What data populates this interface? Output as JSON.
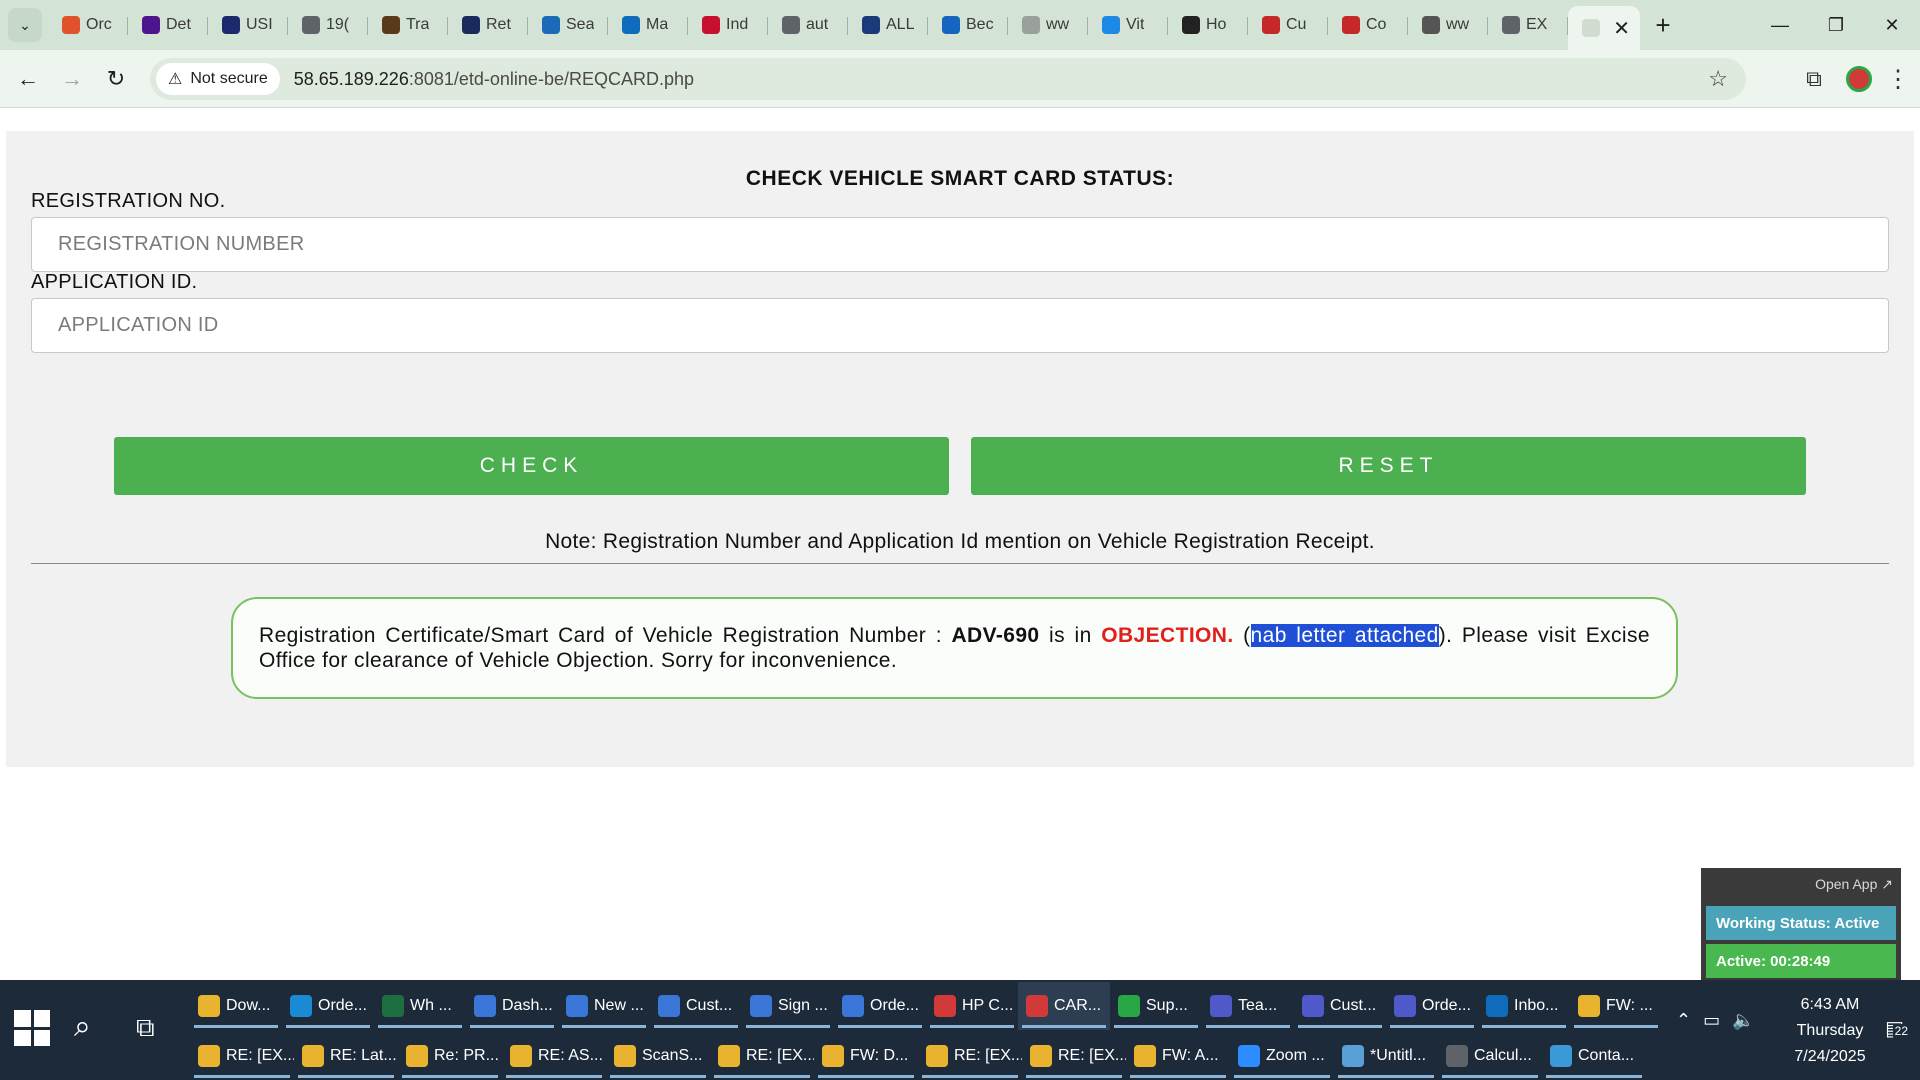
{
  "browser": {
    "tabs": [
      {
        "label": "Orc",
        "icon": "swirl-icon",
        "color": "#e0522c"
      },
      {
        "label": "Det",
        "icon": "fedex-icon",
        "color": "#4d148c"
      },
      {
        "label": "USI",
        "icon": "mail-icon",
        "color": "#1a2a6c"
      },
      {
        "label": "19(",
        "icon": "globe-icon",
        "color": "#5f6368"
      },
      {
        "label": "Tra",
        "icon": "ups-icon",
        "color": "#5a3a1a"
      },
      {
        "label": "Ret",
        "icon": "check-icon",
        "color": "#1a2a5c"
      },
      {
        "label": "Sea",
        "icon": "wave-icon",
        "color": "#1a6ab8"
      },
      {
        "label": "Ma",
        "icon": "outlook-icon",
        "color": "#0f6cbd"
      },
      {
        "label": "Ind",
        "icon": "stripes-icon",
        "color": "#c8102e"
      },
      {
        "label": "aut",
        "icon": "globe-icon",
        "color": "#5f6368"
      },
      {
        "label": "ALL",
        "icon": "seventeen-icon",
        "color": "#1a3a7c"
      },
      {
        "label": "Bec",
        "icon": "f-icon",
        "color": "#1565c0"
      },
      {
        "label": "ww",
        "icon": "loading-icon",
        "color": "#9aa09b"
      },
      {
        "label": "Vit",
        "icon": "dollar-icon",
        "color": "#1e88e5"
      },
      {
        "label": "Ho",
        "icon": "x-icon",
        "color": "#222222"
      },
      {
        "label": "Cu",
        "icon": "red-circle-icon",
        "color": "#c62828"
      },
      {
        "label": "Co",
        "icon": "red-circle-icon",
        "color": "#c62828"
      },
      {
        "label": "ww",
        "icon": "m-icon",
        "color": "#555555"
      },
      {
        "label": "EX",
        "icon": "globe-icon",
        "color": "#5f6368"
      }
    ],
    "active_tab_close": "✕",
    "new_tab": "+",
    "security_label": "Not secure",
    "url_host": "58.65.189.226",
    "url_path": ":8081/etd-online-be/REQCARD.php"
  },
  "page": {
    "title": "CHECK VEHICLE SMART CARD STATUS:",
    "registration_label": "REGISTRATION NO.",
    "registration_placeholder": "REGISTRATION NUMBER",
    "registration_value": "",
    "application_label": "APPLICATION ID.",
    "application_placeholder": "APPLICATION ID",
    "application_value": "",
    "check_button": "CHECK",
    "reset_button": "RESET",
    "note": "Note: Registration Number and Application Id mention on Vehicle Registration Receipt.",
    "result": {
      "prefix": "Registration Certificate/Smart Card of Vehicle Registration Number : ",
      "reg_number": "ADV-690",
      "middle": " is in ",
      "status": "OBJECTION.",
      "paren_open": " (",
      "selected": "nab letter attached",
      "suffix": "). Please visit Excise Office for clearance of Vehicle Objection. Sorry for inconvenience.",
      "status_color": "#e0201c"
    }
  },
  "widget": {
    "open_app": "Open App ↗",
    "working_status": "Working Status: Active",
    "active_time": "Active: 00:28:49"
  },
  "taskbar": {
    "row1": [
      {
        "label": "Dow...",
        "icon": "folder-icon",
        "color": "#e8b430"
      },
      {
        "label": "Orde...",
        "icon": "edge-icon",
        "color": "#1a8ad4"
      },
      {
        "label": "Wh ...",
        "icon": "excel-icon",
        "color": "#1d6f42"
      },
      {
        "label": "Dash...",
        "icon": "chrome-icon",
        "color": "#3a76d8"
      },
      {
        "label": "New ...",
        "icon": "chrome-icon",
        "color": "#3a76d8"
      },
      {
        "label": "Cust...",
        "icon": "chrome-icon",
        "color": "#3a76d8"
      },
      {
        "label": "Sign ...",
        "icon": "chrome-icon",
        "color": "#3a76d8"
      },
      {
        "label": "Orde...",
        "icon": "chrome-icon",
        "color": "#3a76d8"
      },
      {
        "label": "HP C...",
        "icon": "chrome-icon",
        "color": "#d23a3a"
      },
      {
        "label": "CAR...",
        "icon": "chrome-icon",
        "color": "#d23a3a"
      },
      {
        "label": "Sup...",
        "icon": "chrome-icon",
        "color": "#27a845"
      },
      {
        "label": "Tea...",
        "icon": "teams-icon",
        "color": "#5059c9"
      },
      {
        "label": "Cust...",
        "icon": "teams-icon",
        "color": "#5059c9"
      },
      {
        "label": "Orde...",
        "icon": "teams-icon",
        "color": "#5059c9"
      },
      {
        "label": "Inbo...",
        "icon": "outlook-icon",
        "color": "#0f6cbd"
      },
      {
        "label": "FW: ...",
        "icon": "envelope-icon",
        "color": "#e8b430"
      }
    ],
    "row2": [
      {
        "label": "RE: [EX...",
        "icon": "envelope-icon",
        "color": "#e8b430"
      },
      {
        "label": "RE: Lat...",
        "icon": "envelope-icon",
        "color": "#e8b430"
      },
      {
        "label": "Re: PR...",
        "icon": "envelope-icon",
        "color": "#e8b430"
      },
      {
        "label": "RE: AS...",
        "icon": "envelope-icon",
        "color": "#e8b430"
      },
      {
        "label": "ScanS...",
        "icon": "envelope-icon",
        "color": "#e8b430"
      },
      {
        "label": "RE: [EX...",
        "icon": "envelope-icon",
        "color": "#e8b430"
      },
      {
        "label": "FW: D...",
        "icon": "envelope-icon",
        "color": "#e8b430"
      },
      {
        "label": "RE: [EX...",
        "icon": "envelope-icon",
        "color": "#e8b430"
      },
      {
        "label": "RE: [EX...",
        "icon": "envelope-icon",
        "color": "#e8b430"
      },
      {
        "label": "FW: A...",
        "icon": "envelope-icon",
        "color": "#e8b430"
      },
      {
        "label": "Zoom ...",
        "icon": "zoom-icon",
        "color": "#2d8cff"
      },
      {
        "label": "*Untitl...",
        "icon": "notepad-icon",
        "color": "#5aa0d8"
      },
      {
        "label": "Calcul...",
        "icon": "calculator-icon",
        "color": "#5f6368"
      },
      {
        "label": "Conta...",
        "icon": "contact-icon",
        "color": "#3a9ad8"
      }
    ],
    "time": "6:43 AM",
    "day": "Thursday",
    "date": "7/24/2025",
    "notifications": "22"
  }
}
